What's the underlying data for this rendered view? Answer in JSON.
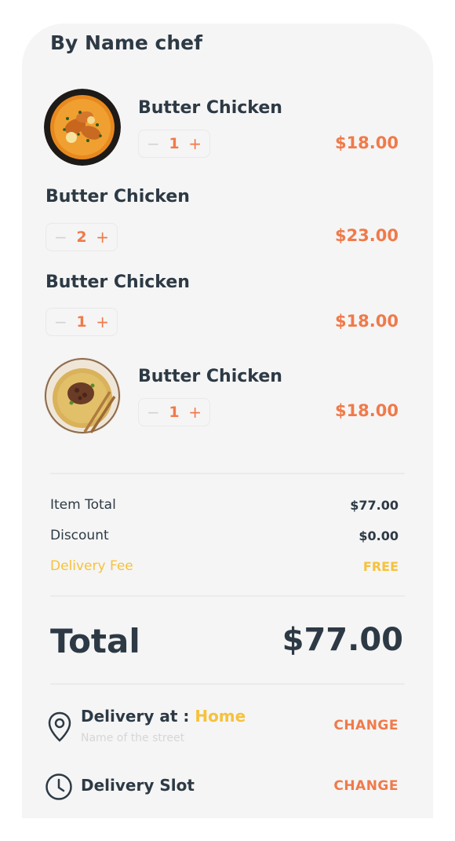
{
  "restaurant": {
    "title": "By Name chef"
  },
  "cart": {
    "items": [
      {
        "name": "Butter Chicken",
        "qty": "1",
        "price": "$18.00",
        "image": "curry-dish-image"
      },
      {
        "name": "Butter Chicken",
        "qty": "2",
        "price": "$23.00"
      },
      {
        "name": "Butter Chicken",
        "qty": "1",
        "price": "$18.00"
      },
      {
        "name": "Butter Chicken",
        "qty": "1",
        "price": "$18.00",
        "image": "noodle-dish-image"
      }
    ],
    "stepper": {
      "minus": "−",
      "plus": "+"
    }
  },
  "summary": {
    "item_total_label": "Item Total",
    "item_total_value": "$77.00",
    "discount_label": "Discount",
    "discount_value": "$0.00",
    "delivery_fee_label": "Delivery Fee",
    "delivery_fee_value": "FREE"
  },
  "total": {
    "label": "Total",
    "value": "$77.00"
  },
  "delivery": {
    "address_label": "Delivery at : ",
    "address_value": "Home",
    "street_placeholder": "Name of the street",
    "address_change": "CHANGE",
    "slot_label": "Delivery Slot",
    "slot_change": "CHANGE"
  },
  "colors": {
    "accent": "#f07a4a",
    "highlight": "#f6c23c",
    "text": "#2d3a45",
    "card": "#f5f5f5"
  }
}
